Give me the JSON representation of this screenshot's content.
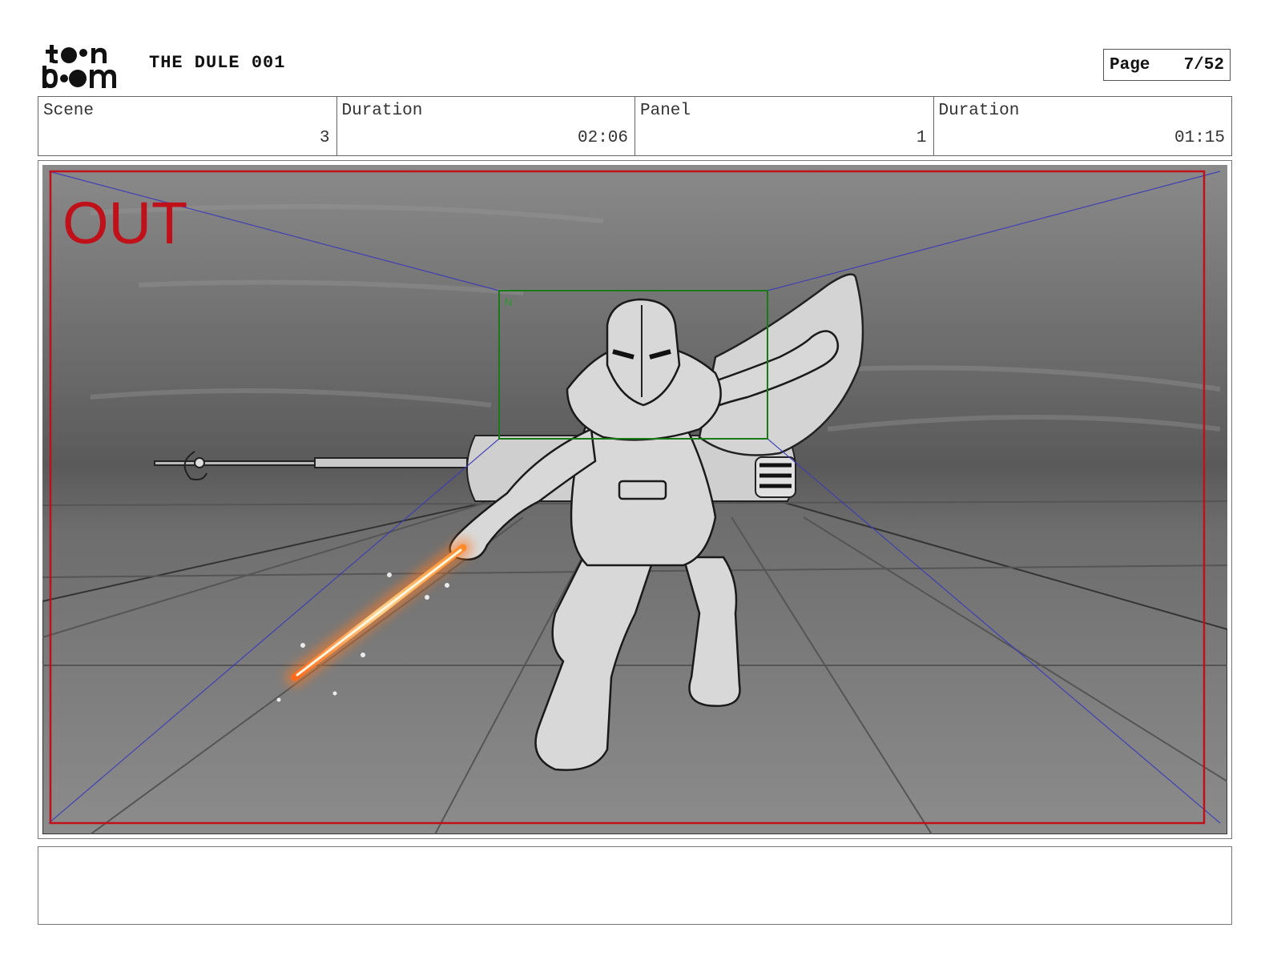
{
  "header": {
    "project_title": "THE DULE 001",
    "logo_alt": "toon boom",
    "page_label": "Page",
    "page_value": "7/52"
  },
  "info": {
    "scene_label": "Scene",
    "scene_value": "3",
    "scene_duration_label": "Duration",
    "scene_duration_value": "02:06",
    "panel_label": "Panel",
    "panel_value": "1",
    "panel_duration_label": "Duration",
    "panel_duration_value": "01:15"
  },
  "panel": {
    "camera_label": "OUT",
    "camera_frame_color": "#c0101a",
    "field_guide_color": "#1a7a1a",
    "perspective_color": "#3a3ab8",
    "saber_color": "#ff9a3c"
  },
  "notes": {
    "text": ""
  }
}
